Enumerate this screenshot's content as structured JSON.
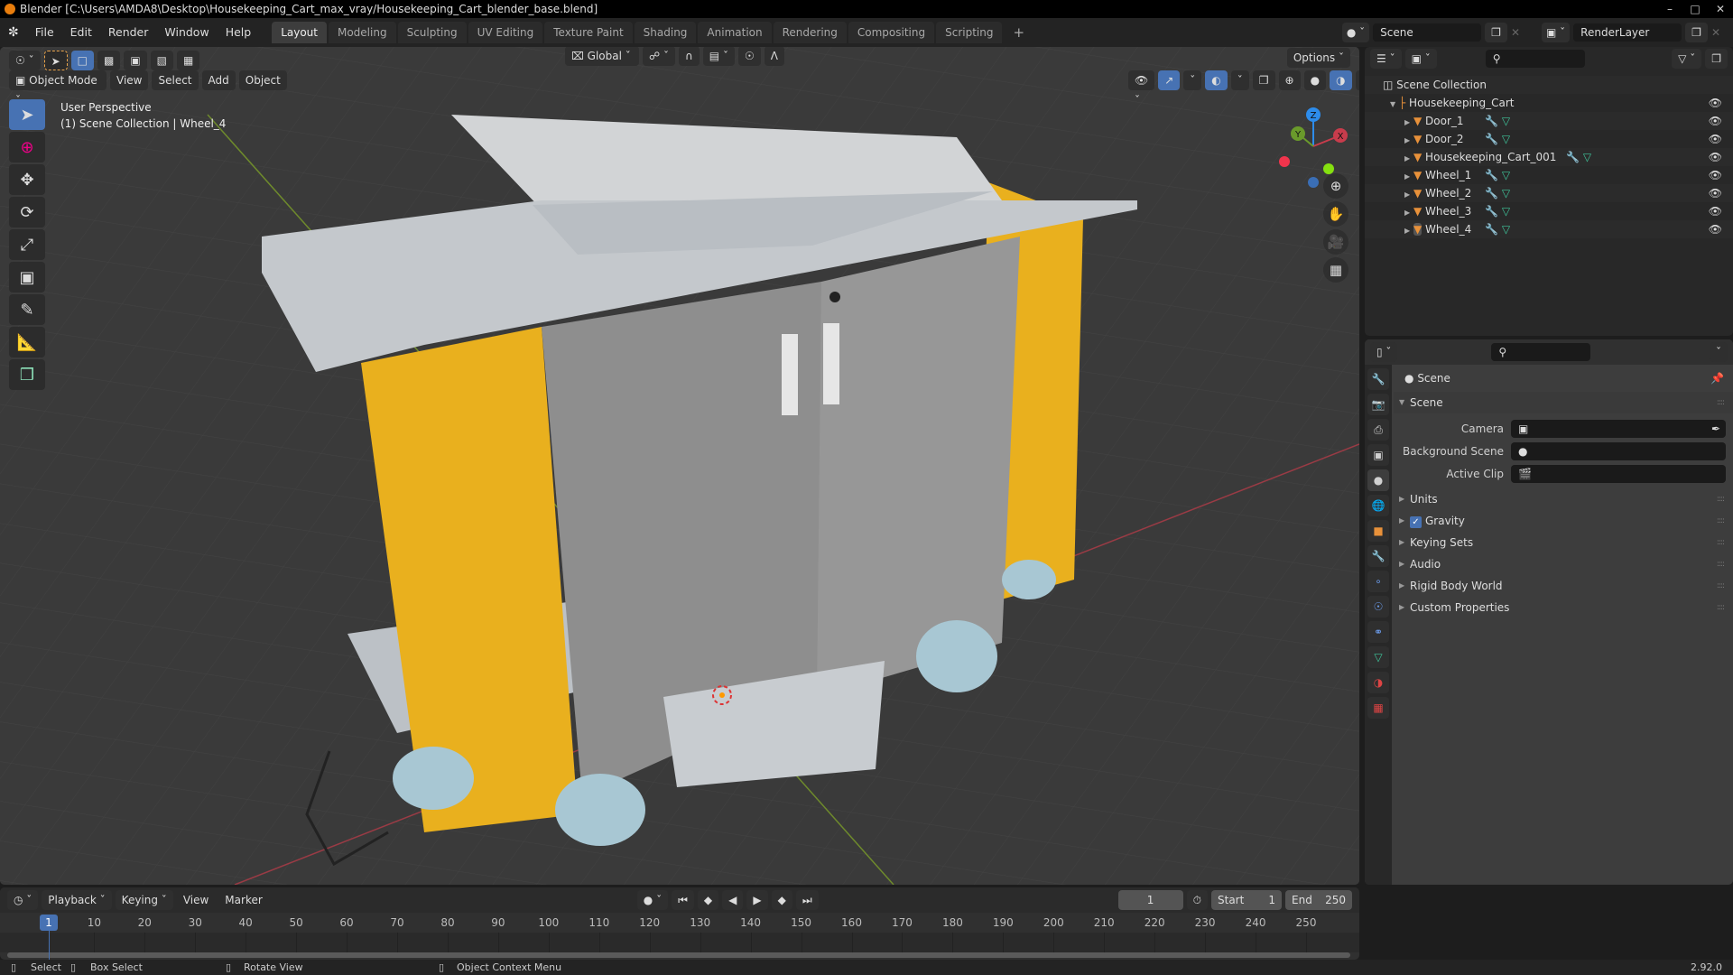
{
  "window": {
    "title": "Blender [C:\\Users\\AMDA8\\Desktop\\Housekeeping_Cart_max_vray/Housekeeping_Cart_blender_base.blend]",
    "controls": [
      "minimize",
      "maximize",
      "close"
    ]
  },
  "menubar": {
    "items": [
      "File",
      "Edit",
      "Render",
      "Window",
      "Help"
    ],
    "workspaces": [
      "Layout",
      "Modeling",
      "Sculpting",
      "UV Editing",
      "Texture Paint",
      "Shading",
      "Animation",
      "Rendering",
      "Compositing",
      "Scripting"
    ],
    "active_workspace": "Layout",
    "add_workspace": "+",
    "scene": "Scene",
    "view_layer": "RenderLayer"
  },
  "viewport": {
    "mode": "Object Mode",
    "menus": [
      "View",
      "Select",
      "Add",
      "Object"
    ],
    "transform_orientation": "Global",
    "options_label": "Options",
    "overlay_line1": "User Perspective",
    "overlay_line2": "(1) Scene Collection | Wheel_4",
    "gizmo_axes": {
      "x": "X",
      "y": "Y",
      "z": "Z"
    },
    "shading_active": "material-preview",
    "colors": {
      "x_axis": "#c83c4c",
      "y_axis": "#6a9a2b",
      "z_axis": "#2d8ceb",
      "accent": "#4772b3"
    }
  },
  "tools": [
    "select-box",
    "cursor",
    "move",
    "rotate",
    "scale",
    "transform",
    "annotate",
    "measure",
    "add-cube"
  ],
  "nav_gizmos": [
    "zoom",
    "pan",
    "camera",
    "perspective-toggle"
  ],
  "outliner": {
    "root": "Scene Collection",
    "collection": "Housekeeping_Cart",
    "objects": [
      {
        "name": "Door_1",
        "has_modifier": true,
        "has_mesh": true,
        "visible": true
      },
      {
        "name": "Door_2",
        "has_modifier": true,
        "has_mesh": true,
        "visible": true
      },
      {
        "name": "Housekeeping_Cart_001",
        "has_modifier": true,
        "has_mesh": true,
        "visible": true
      },
      {
        "name": "Wheel_1",
        "has_modifier": true,
        "has_mesh": true,
        "visible": true
      },
      {
        "name": "Wheel_2",
        "has_modifier": true,
        "has_mesh": true,
        "visible": true
      },
      {
        "name": "Wheel_3",
        "has_modifier": true,
        "has_mesh": true,
        "visible": true
      },
      {
        "name": "Wheel_4",
        "has_modifier": true,
        "has_mesh": true,
        "visible": true,
        "active": true
      }
    ]
  },
  "properties": {
    "context": "Scene",
    "section": "Scene",
    "fields": [
      {
        "label": "Camera",
        "value": ""
      },
      {
        "label": "Background Scene",
        "value": ""
      },
      {
        "label": "Active Clip",
        "value": ""
      }
    ],
    "panels": [
      {
        "label": "Units"
      },
      {
        "label": "Gravity",
        "checkbox": true,
        "checked": true
      },
      {
        "label": "Keying Sets"
      },
      {
        "label": "Audio"
      },
      {
        "label": "Rigid Body World"
      },
      {
        "label": "Custom Properties"
      }
    ],
    "tabs": [
      "tool",
      "render",
      "output",
      "view-layer",
      "scene",
      "world",
      "object",
      "modifiers",
      "particles",
      "physics",
      "constraints",
      "data",
      "material",
      "texture"
    ],
    "active_tab": "scene"
  },
  "timeline": {
    "menus": [
      "Playback",
      "Keying",
      "View",
      "Marker"
    ],
    "current_frame": "1",
    "start_label": "Start",
    "start": "1",
    "end_label": "End",
    "end": "250",
    "ticks": [
      "10",
      "20",
      "30",
      "40",
      "50",
      "60",
      "70",
      "80",
      "90",
      "100",
      "110",
      "120",
      "130",
      "140",
      "150",
      "160",
      "170",
      "180",
      "190",
      "200",
      "210",
      "220",
      "230",
      "240",
      "250"
    ],
    "playhead_label": "1"
  },
  "statusbar": {
    "hints": [
      "Select",
      "Box Select",
      "Rotate View",
      "Object Context Menu"
    ],
    "version": "2.92.0"
  }
}
